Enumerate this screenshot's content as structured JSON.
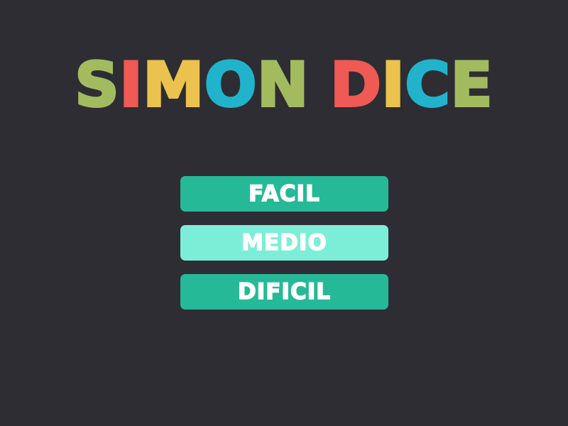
{
  "title": {
    "words": [
      {
        "letters": [
          {
            "char": "S",
            "color": "#a2bb5f"
          },
          {
            "char": "I",
            "color": "#ef5a55"
          },
          {
            "char": "M",
            "color": "#ebc24e"
          },
          {
            "char": "O",
            "color": "#21b3cc"
          },
          {
            "char": "N",
            "color": "#a2bb5f"
          }
        ]
      },
      {
        "letters": [
          {
            "char": "D",
            "color": "#ef5a55"
          },
          {
            "char": "I",
            "color": "#ebc24e"
          },
          {
            "char": "C",
            "color": "#21b3cc"
          },
          {
            "char": "E",
            "color": "#a2bb5f"
          }
        ]
      }
    ]
  },
  "menu": {
    "buttons": [
      {
        "label": "FACIL",
        "color": "#25b997"
      },
      {
        "label": "MEDIO",
        "color": "#7ceed7"
      },
      {
        "label": "DIFICIL",
        "color": "#25b997"
      }
    ]
  },
  "colors": {
    "background": "#2e2d33"
  }
}
